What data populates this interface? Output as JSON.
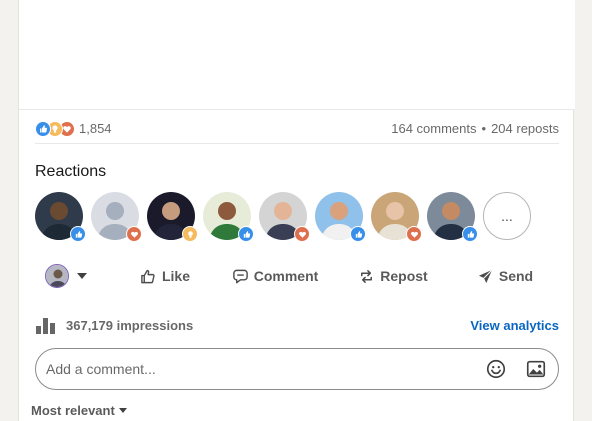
{
  "post": {
    "reaction_count": "1,854",
    "comments": "164 comments",
    "separator": "•",
    "reposts": "204 reposts"
  },
  "reactions": {
    "title": "Reactions",
    "more_label": "...",
    "people": [
      {
        "reaction": "like",
        "skin": "#6b4a32",
        "bg": "#2f3b4a",
        "shirt": "#1d2a36"
      },
      {
        "reaction": "love",
        "skin": "#a5afbd",
        "bg": "#d9dde3",
        "shirt": "#a5afbd"
      },
      {
        "reaction": "insight",
        "skin": "#c69c7e",
        "bg": "#1a1a2a",
        "shirt": "#22253a"
      },
      {
        "reaction": "like",
        "skin": "#8d5a3d",
        "bg": "#e6ecd8",
        "shirt": "#2f7a3b"
      },
      {
        "reaction": "love",
        "skin": "#e3b596",
        "bg": "#d4d4d4",
        "shirt": "#3a3f55"
      },
      {
        "reaction": "like",
        "skin": "#d9a27c",
        "bg": "#8fc1ea",
        "shirt": "#f1f1f1"
      },
      {
        "reaction": "love",
        "skin": "#e7c3a8",
        "bg": "#c9a577",
        "shirt": "#e8e2d6"
      },
      {
        "reaction": "like",
        "skin": "#c48a63",
        "bg": "#7c8a9a",
        "shirt": "#233044"
      }
    ]
  },
  "actions": {
    "like": "Like",
    "comment": "Comment",
    "repost": "Repost",
    "send": "Send"
  },
  "stats": {
    "impressions": "367,179 impressions",
    "view_analytics": "View analytics"
  },
  "comment_box": {
    "placeholder": "Add a comment..."
  },
  "sort": {
    "label": "Most relevant"
  },
  "colors": {
    "like": "#378fe9",
    "love": "#df704d",
    "insight": "#f5bb5c",
    "link": "#0a66c2"
  }
}
